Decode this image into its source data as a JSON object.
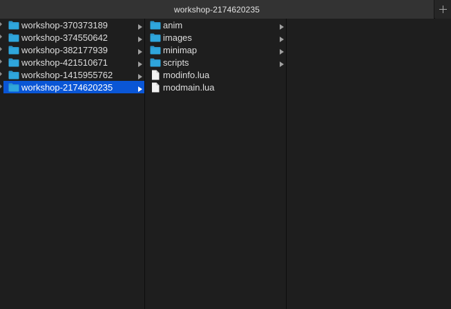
{
  "window": {
    "tab_title": "workshop-2174620235",
    "new_tab_icon": "plus-icon"
  },
  "colors": {
    "background": "#1e1e1e",
    "tab_active": "#333333",
    "selection": "#0a56d6",
    "folder": "#2fa6dc",
    "text": "#dedede"
  },
  "column1": {
    "items": [
      {
        "label": "workshop-370373189",
        "icon": "folder-icon",
        "has_children": true,
        "selected": false
      },
      {
        "label": "workshop-374550642",
        "icon": "folder-icon",
        "has_children": true,
        "selected": false
      },
      {
        "label": "workshop-382177939",
        "icon": "folder-icon",
        "has_children": true,
        "selected": false
      },
      {
        "label": "workshop-421510671",
        "icon": "folder-icon",
        "has_children": true,
        "selected": false
      },
      {
        "label": "workshop-1415955762",
        "icon": "folder-icon",
        "has_children": true,
        "selected": false
      },
      {
        "label": "workshop-2174620235",
        "icon": "folder-icon",
        "has_children": true,
        "selected": true
      }
    ]
  },
  "column2": {
    "items": [
      {
        "label": "anim",
        "icon": "folder-icon",
        "has_children": true
      },
      {
        "label": "images",
        "icon": "folder-icon",
        "has_children": true
      },
      {
        "label": "minimap",
        "icon": "folder-icon",
        "has_children": true
      },
      {
        "label": "scripts",
        "icon": "folder-icon",
        "has_children": true
      },
      {
        "label": "modinfo.lua",
        "icon": "file-icon",
        "has_children": false
      },
      {
        "label": "modmain.lua",
        "icon": "file-icon",
        "has_children": false
      }
    ]
  }
}
